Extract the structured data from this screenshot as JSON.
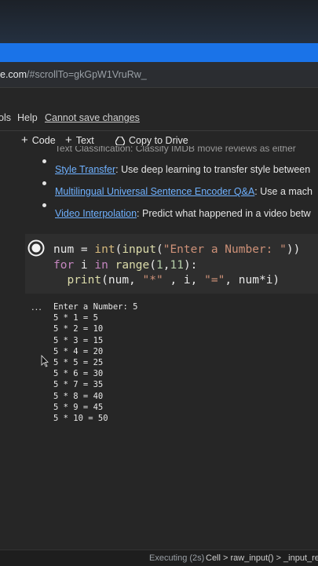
{
  "browser": {
    "url_host": "e.com",
    "url_path": "/#scrollTo=gkGpW1VruRw_"
  },
  "menu": {
    "items": [
      "ols",
      "Help"
    ],
    "unsaved": "Cannot save changes"
  },
  "toolbar": {
    "code_label": "Code",
    "text_label": "Text",
    "drive_label": "Copy to Drive"
  },
  "text_cell": {
    "faded_line": "Text Classification: Classify IMDB movie reviews as either",
    "bullets": [
      {
        "link": "Style Transfer",
        "rest": ": Use deep learning to transfer style between"
      },
      {
        "link": "Multilingual Universal Sentence Encoder Q&A",
        "rest": ": Use a mach"
      },
      {
        "link": "Video Interpolation",
        "rest": ": Predict what happened in a video betw"
      }
    ]
  },
  "code_cell": {
    "lines": [
      "num = int(input(\"Enter a Number: \"))",
      "for i in range(1,11):",
      "  print(num, \"*\" , i, \"=\", num*i)"
    ]
  },
  "output": {
    "ellipsis": "...",
    "lines": [
      "Enter a Number: 5",
      "5 * 1 = 5",
      "5 * 2 = 10",
      "5 * 3 = 15",
      "5 * 4 = 20",
      "5 * 5 = 25",
      "5 * 6 = 30",
      "5 * 7 = 35",
      "5 * 8 = 40",
      "5 * 9 = 45",
      "5 * 10 = 50"
    ]
  },
  "status": {
    "executing": "Executing (2s)",
    "crumbs": "Cell > raw_input() > _input_req"
  },
  "colors": {
    "accent": "#1a73e8",
    "link": "#6fb1ff",
    "background": "#262626"
  }
}
